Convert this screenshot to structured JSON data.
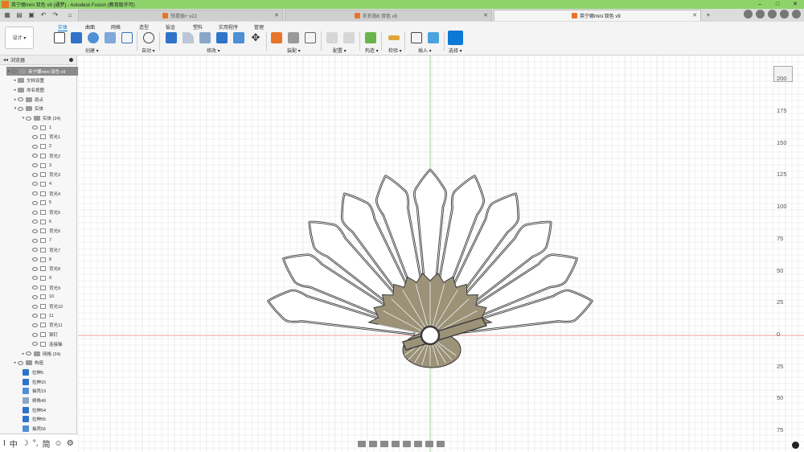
{
  "window": {
    "title": "英宁娜mini 双色 v9 (通梦) - Autodesk Fusion (教育版许可)",
    "controls": [
      "–",
      "□",
      "✕"
    ]
  },
  "doc_tabs": [
    {
      "label": "铁提扇+ v22",
      "active": false
    },
    {
      "label": "折折扇6 双色 v8",
      "active": false
    },
    {
      "label": "英宁娜mini 双色 v9",
      "active": true
    }
  ],
  "toolbar": {
    "workspace_label": "设计 ▾",
    "tabs": [
      "实体",
      "曲面",
      "网格",
      "造型",
      "钣金",
      "塑料",
      "实用程序",
      "管理"
    ],
    "active_tab": "实体",
    "groups": [
      "创建 ▾",
      "自动 ▾",
      "修改 ▾",
      "装配 ▾",
      "配置 ▾",
      "构造 ▾",
      "检验 ▾",
      "插入 ▾",
      "选择 ▾"
    ]
  },
  "browser": {
    "header": "浏览器",
    "root": "英宁娜mini 双色 v9",
    "nodes": [
      "文档设置",
      "命名视图",
      "原点",
      "实体"
    ],
    "bodies_folder": "实体 (24)",
    "bodies": [
      "1",
      "背光1",
      "2",
      "背光2",
      "3",
      "背光3",
      "4",
      "背光4",
      "5",
      "背光5",
      "6",
      "背光6",
      "7",
      "背光7",
      "8",
      "背光8",
      "9",
      "背光9",
      "10",
      "背光10",
      "11",
      "背光11",
      "铆钉",
      "连接轴"
    ],
    "mesh_folder": "网格 (24)",
    "construction": "构造",
    "features": [
      "拉伸5",
      "拉伸15",
      "抽壳19",
      "倒角49",
      "拉伸54",
      "拉伸55",
      "抽壳56"
    ]
  },
  "ime_bar": [
    "中",
    "简"
  ],
  "ruler": {
    "labels": [
      "200",
      "175",
      "150",
      "125",
      "100",
      "75",
      "50",
      "25",
      "0",
      "25",
      "50",
      "75"
    ]
  },
  "colors": {
    "titlebar": "#8ed36a",
    "accent": "#0a78d4",
    "fan_body": "#ffffff",
    "fan_outline": "#3a3a3a",
    "fan_base": "#9b9278",
    "grid": "#e3e3e3",
    "axis_green": "#9fd89f",
    "axis_red": "#f0a0a0"
  }
}
